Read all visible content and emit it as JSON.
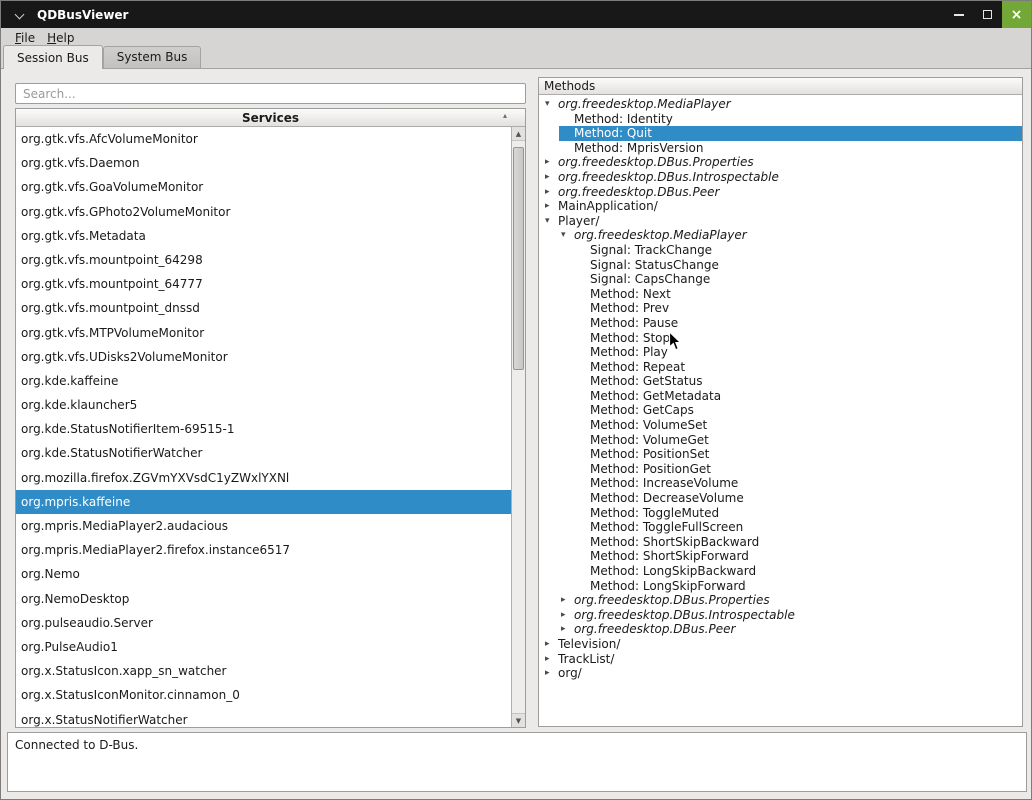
{
  "window": {
    "title": "QDBusViewer"
  },
  "icons": {
    "close": "×",
    "sort": "▴",
    "scroll_up": "▲",
    "scroll_down": "▼",
    "collapsed": "▸",
    "expanded": "▾"
  },
  "colors": {
    "selection": "#308cc6",
    "close_button": "#73a839",
    "titlebar": "#181818"
  },
  "menubar": {
    "items": [
      {
        "label": "File",
        "accel_index": 0
      },
      {
        "label": "Help",
        "accel_index": 0
      }
    ]
  },
  "tabs": [
    {
      "label": "Session Bus",
      "active": true
    },
    {
      "label": "System Bus",
      "active": false
    }
  ],
  "services_panel": {
    "search_placeholder": "Search...",
    "header": "Services",
    "selected": "org.mpris.kaffeine",
    "items": [
      "org.gtk.vfs.AfcVolumeMonitor",
      "org.gtk.vfs.Daemon",
      "org.gtk.vfs.GoaVolumeMonitor",
      "org.gtk.vfs.GPhoto2VolumeMonitor",
      "org.gtk.vfs.Metadata",
      "org.gtk.vfs.mountpoint_64298",
      "org.gtk.vfs.mountpoint_64777",
      "org.gtk.vfs.mountpoint_dnssd",
      "org.gtk.vfs.MTPVolumeMonitor",
      "org.gtk.vfs.UDisks2VolumeMonitor",
      "org.kde.kaffeine",
      "org.kde.klauncher5",
      "org.kde.StatusNotifierItem-69515-1",
      "org.kde.StatusNotifierWatcher",
      "org.mozilla.firefox.ZGVmYXVsdC1yZWxlYXNl",
      "org.mpris.kaffeine",
      "org.mpris.MediaPlayer2.audacious",
      "org.mpris.MediaPlayer2.firefox.instance6517",
      "org.Nemo",
      "org.NemoDesktop",
      "org.pulseaudio.Server",
      "org.PulseAudio1",
      "org.x.StatusIcon.xapp_sn_watcher",
      "org.x.StatusIconMonitor.cinnamon_0",
      "org.x.StatusNotifierWatcher"
    ]
  },
  "methods_panel": {
    "header": "Methods",
    "selected": "Method: Quit",
    "tree": [
      {
        "label": "org.freedesktop.MediaPlayer",
        "level": 0,
        "expand": "open",
        "italic": true,
        "selected": false
      },
      {
        "label": "Method: Identity",
        "level": 1,
        "expand": null,
        "italic": false,
        "selected": false
      },
      {
        "label": "Method: Quit",
        "level": 1,
        "expand": null,
        "italic": false,
        "selected": true
      },
      {
        "label": "Method: MprisVersion",
        "level": 1,
        "expand": null,
        "italic": false,
        "selected": false
      },
      {
        "label": "org.freedesktop.DBus.Properties",
        "level": 0,
        "expand": "closed",
        "italic": true,
        "selected": false
      },
      {
        "label": "org.freedesktop.DBus.Introspectable",
        "level": 0,
        "expand": "closed",
        "italic": true,
        "selected": false
      },
      {
        "label": "org.freedesktop.DBus.Peer",
        "level": 0,
        "expand": "closed",
        "italic": true,
        "selected": false
      },
      {
        "label": "MainApplication/",
        "level": 0,
        "expand": "closed",
        "italic": false,
        "selected": false
      },
      {
        "label": "Player/",
        "level": 0,
        "expand": "open",
        "italic": false,
        "selected": false
      },
      {
        "label": "org.freedesktop.MediaPlayer",
        "level": 1,
        "expand": "open",
        "italic": true,
        "selected": false
      },
      {
        "label": "Signal: TrackChange",
        "level": 2,
        "expand": null,
        "italic": false,
        "selected": false
      },
      {
        "label": "Signal: StatusChange",
        "level": 2,
        "expand": null,
        "italic": false,
        "selected": false
      },
      {
        "label": "Signal: CapsChange",
        "level": 2,
        "expand": null,
        "italic": false,
        "selected": false
      },
      {
        "label": "Method: Next",
        "level": 2,
        "expand": null,
        "italic": false,
        "selected": false
      },
      {
        "label": "Method: Prev",
        "level": 2,
        "expand": null,
        "italic": false,
        "selected": false
      },
      {
        "label": "Method: Pause",
        "level": 2,
        "expand": null,
        "italic": false,
        "selected": false
      },
      {
        "label": "Method: Stop",
        "level": 2,
        "expand": null,
        "italic": false,
        "selected": false
      },
      {
        "label": "Method: Play",
        "level": 2,
        "expand": null,
        "italic": false,
        "selected": false
      },
      {
        "label": "Method: Repeat",
        "level": 2,
        "expand": null,
        "italic": false,
        "selected": false
      },
      {
        "label": "Method: GetStatus",
        "level": 2,
        "expand": null,
        "italic": false,
        "selected": false
      },
      {
        "label": "Method: GetMetadata",
        "level": 2,
        "expand": null,
        "italic": false,
        "selected": false
      },
      {
        "label": "Method: GetCaps",
        "level": 2,
        "expand": null,
        "italic": false,
        "selected": false
      },
      {
        "label": "Method: VolumeSet",
        "level": 2,
        "expand": null,
        "italic": false,
        "selected": false
      },
      {
        "label": "Method: VolumeGet",
        "level": 2,
        "expand": null,
        "italic": false,
        "selected": false
      },
      {
        "label": "Method: PositionSet",
        "level": 2,
        "expand": null,
        "italic": false,
        "selected": false
      },
      {
        "label": "Method: PositionGet",
        "level": 2,
        "expand": null,
        "italic": false,
        "selected": false
      },
      {
        "label": "Method: IncreaseVolume",
        "level": 2,
        "expand": null,
        "italic": false,
        "selected": false
      },
      {
        "label": "Method: DecreaseVolume",
        "level": 2,
        "expand": null,
        "italic": false,
        "selected": false
      },
      {
        "label": "Method: ToggleMuted",
        "level": 2,
        "expand": null,
        "italic": false,
        "selected": false
      },
      {
        "label": "Method: ToggleFullScreen",
        "level": 2,
        "expand": null,
        "italic": false,
        "selected": false
      },
      {
        "label": "Method: ShortSkipBackward",
        "level": 2,
        "expand": null,
        "italic": false,
        "selected": false
      },
      {
        "label": "Method: ShortSkipForward",
        "level": 2,
        "expand": null,
        "italic": false,
        "selected": false
      },
      {
        "label": "Method: LongSkipBackward",
        "level": 2,
        "expand": null,
        "italic": false,
        "selected": false
      },
      {
        "label": "Method: LongSkipForward",
        "level": 2,
        "expand": null,
        "italic": false,
        "selected": false
      },
      {
        "label": "org.freedesktop.DBus.Properties",
        "level": 1,
        "expand": "closed",
        "italic": true,
        "selected": false
      },
      {
        "label": "org.freedesktop.DBus.Introspectable",
        "level": 1,
        "expand": "closed",
        "italic": true,
        "selected": false
      },
      {
        "label": "org.freedesktop.DBus.Peer",
        "level": 1,
        "expand": "closed",
        "italic": true,
        "selected": false
      },
      {
        "label": "Television/",
        "level": 0,
        "expand": "closed",
        "italic": false,
        "selected": false
      },
      {
        "label": "TrackList/",
        "level": 0,
        "expand": "closed",
        "italic": false,
        "selected": false
      },
      {
        "label": "org/",
        "level": 0,
        "expand": "closed",
        "italic": false,
        "selected": false
      }
    ]
  },
  "status": {
    "text": "Connected to D-Bus."
  }
}
